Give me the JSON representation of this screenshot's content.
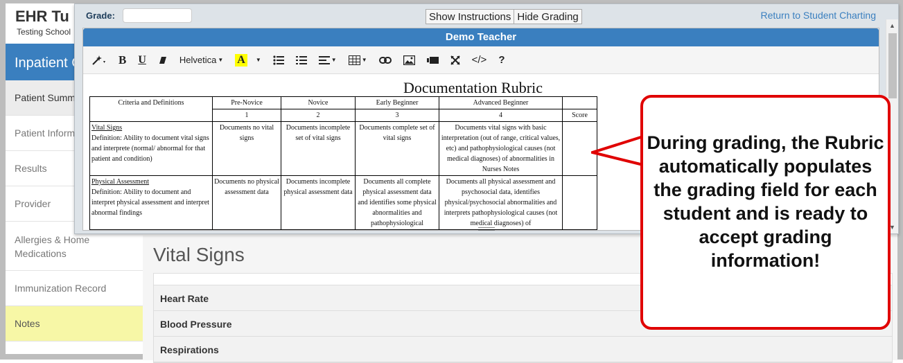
{
  "app": {
    "logo": "EHR Tu",
    "school": "Testing School",
    "section_title": "Inpatient C"
  },
  "sidebar": {
    "items": [
      {
        "label": "Patient Summ"
      },
      {
        "label": "Patient Inform"
      },
      {
        "label": "Results"
      },
      {
        "label": "Provider"
      },
      {
        "label": "Allergies & Home Medications"
      },
      {
        "label": "Immunization Record"
      },
      {
        "label": "Notes"
      }
    ]
  },
  "main": {
    "title": "Vital Signs",
    "rows": [
      "Heart Rate",
      "Blood Pressure",
      "Respirations"
    ]
  },
  "grading": {
    "grade_label": "Grade:",
    "grade_value": "",
    "show_instructions": "Show Instructions",
    "hide_grading": "Hide Grading",
    "return_link": "Return to Student Charting",
    "editor_title": "Demo Teacher",
    "toolbar": {
      "bold": "B",
      "underline": "U",
      "font": "Helvetica",
      "highlight": "A",
      "help": "?",
      "code": "</>"
    }
  },
  "rubric": {
    "title": "Documentation Rubric",
    "header": {
      "criteria": "Criteria and Definitions",
      "levels": [
        "Pre-Novice",
        "Novice",
        "Early Beginner",
        "Advanced Beginner"
      ],
      "numbers": [
        "1",
        "2",
        "3",
        "4"
      ],
      "score": "Score"
    },
    "rows": [
      {
        "name": "Vital Signs",
        "definition": "Definition:  Ability to document vital signs and interprete (normal/ abnormal for that patient and condition)",
        "cells": [
          "Documents no vital signs",
          "Documents incomplete set of vital signs",
          "Documents complete set of vital signs",
          "Documents vital signs with basic interpretation (out of range, critical values, etc) and  pathophysiological causes (not medical diagnoses) of abnormalities in Nurses Notes"
        ]
      },
      {
        "name": "Physical Assessment",
        "definition": "Definition:  Ability to document and interpret physical assessment and interpret abnormal findings",
        "cells": [
          "Documents no physical assessment data",
          "Documents incomplete physical assessment data",
          "Documents all complete physical assessment data and identifies some physical abnormalities and pathophysiological",
          "Documents all physical assessment and psychosocial data, identifies physical/psychosocial abnormalities and interprets pathophysiological causes (not medical diagnoses) of"
        ]
      }
    ]
  },
  "callout": {
    "text": "During grading, the Rubric automatically populates the grading field for each student and is ready to accept grading information!"
  },
  "colors": {
    "accent": "#3a7fbf",
    "callout_border": "#e00000",
    "notes_highlight": "#f7f7a6"
  }
}
